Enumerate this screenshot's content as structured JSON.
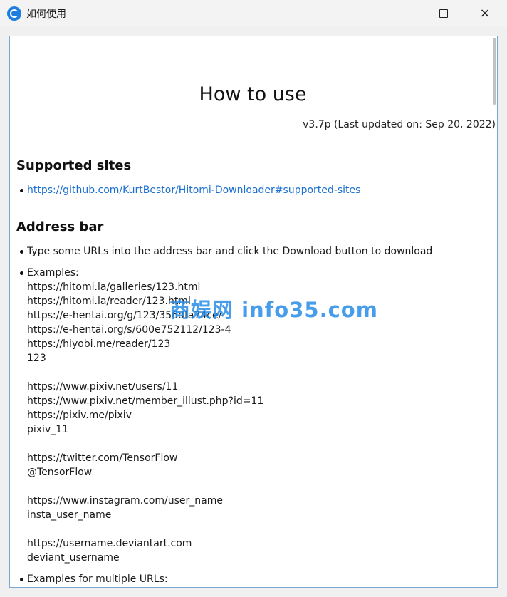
{
  "window": {
    "title": "如何使用",
    "controls": {
      "minimize": "minimize",
      "maximize": "maximize",
      "close": "×"
    }
  },
  "doc": {
    "title": "How to use",
    "version": "v3.7p (Last updated on: Sep 20, 2022)",
    "supported": {
      "heading": "Supported sites",
      "link": "https://github.com/KurtBestor/Hitomi-Downloader#supported-sites"
    },
    "address": {
      "heading": "Address bar",
      "bullet1": "Type some URLs into the address bar and click the Download button to download",
      "examples_label": "Examples:",
      "examples": [
        "https://hitomi.la/galleries/123.html",
        "https://hitomi.la/reader/123.html",
        "https://e-hentai.org/g/123/356dfa74ce/",
        "https://e-hentai.org/s/600e752112/123-4",
        "https://hiyobi.me/reader/123",
        "123",
        "",
        "https://www.pixiv.net/users/11",
        "https://www.pixiv.net/member_illust.php?id=11",
        "https://pixiv.me/pixiv",
        "pixiv_11",
        "",
        "https://twitter.com/TensorFlow",
        "@TensorFlow",
        "",
        "https://www.instagram.com/user_name",
        "insta_user_name",
        "",
        "https://username.deviantart.com",
        "deviant_username"
      ],
      "multiple_label": "Examples for multiple URLs:"
    }
  },
  "watermark": "商娱网 info35.com",
  "colors": {
    "link": "#1a6fd0",
    "accent": "#1e7ee0",
    "border": "#7aa7d2"
  }
}
